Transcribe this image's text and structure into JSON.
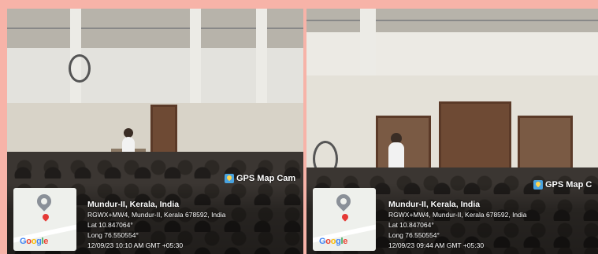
{
  "photos": [
    {
      "badge": "GPS Map Cam",
      "city": "Mundur-II, Kerala, India",
      "address": "RGWX+MW4, Mundur-II, Kerala 678592, India",
      "lat": "Lat 10.847064°",
      "long": "Long 76.550554°",
      "datetime": "12/09/23 10:10 AM GMT +05:30",
      "map_logo": "Google"
    },
    {
      "badge": "GPS Map C",
      "city": "Mundur-II, Kerala, India",
      "address": "RGWX+MW4, Mundur-II, Kerala 678592, India",
      "lat": "Lat 10.847064°",
      "long": "Long 76.550554°",
      "datetime": "12/09/23 09:44 AM GMT +05:30",
      "map_logo": "Google"
    }
  ],
  "colors": {
    "frame": "#f7b3a8",
    "badge_icon": "#4aa3df",
    "map_pin": "#e53935"
  }
}
